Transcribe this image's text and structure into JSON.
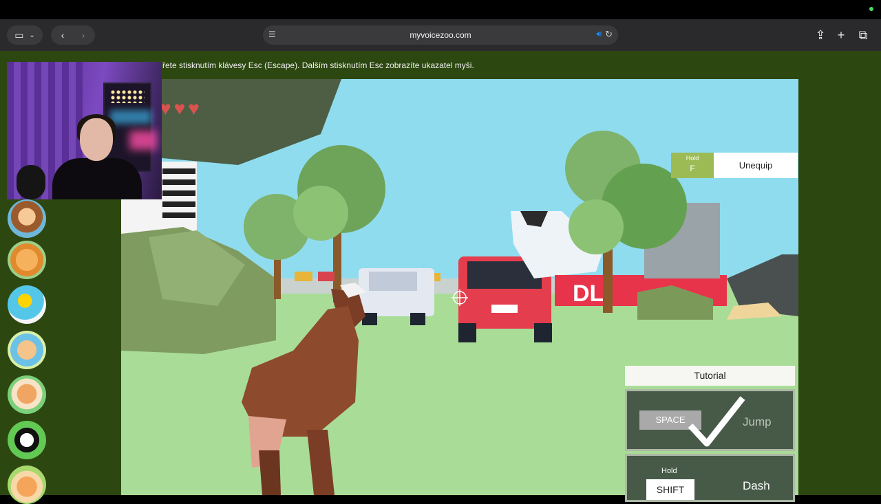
{
  "browser": {
    "url": "myvoicezoo.com"
  },
  "page": {
    "notice": "řete stisknutím klávesy Esc (Escape). Dalším stisknutím Esc zobrazíte ukazatel myši."
  },
  "game": {
    "hearts": {
      "count": 3,
      "glyph": "♥"
    },
    "equip_hint": {
      "hold": "Hold",
      "key": "F",
      "action": "Unequip"
    },
    "billboard_text": "DL",
    "tutorial": {
      "title": "Tutorial",
      "jump": {
        "key": "SPACE",
        "action": "Jump",
        "completed": true
      },
      "dash": {
        "hold": "Hold",
        "key": "SHIFT",
        "action": "Dash"
      }
    }
  },
  "sidebar": {
    "avatars": [
      {
        "name": "bear-detective-avatar"
      },
      {
        "name": "tabby-cat-avatar"
      },
      {
        "name": "pacman-party-avatar"
      },
      {
        "name": "puppy-duo-avatar"
      },
      {
        "name": "corgi-avatar"
      },
      {
        "name": "panda-avatar"
      },
      {
        "name": "kittens-avatar"
      }
    ]
  },
  "colors": {
    "page_bg": "#2d4711",
    "toolbar_bg": "#2a2a2c",
    "hint_key_bg": "#9cbb55",
    "tutorial_card_bg": "#475a48",
    "heart": "#d9534f"
  }
}
